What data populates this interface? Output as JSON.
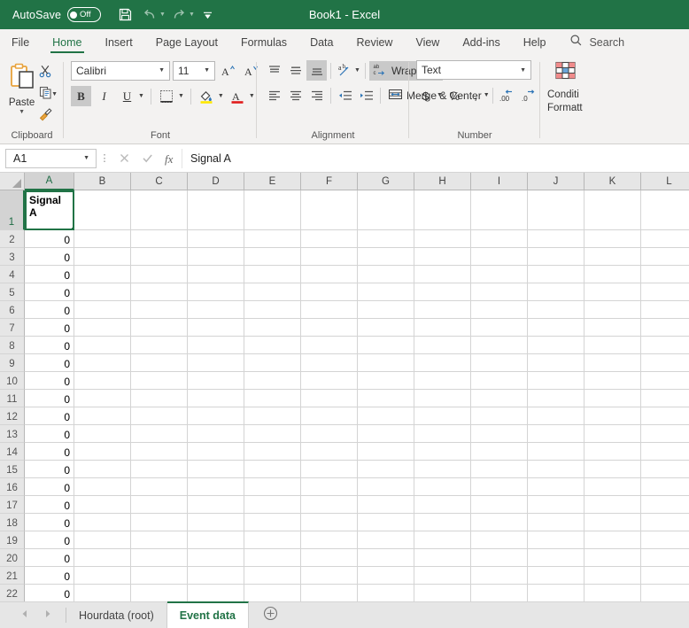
{
  "titlebar": {
    "autosave_label": "AutoSave",
    "autosave_state": "Off",
    "document_title": "Book1  -  Excel",
    "save_icon": "save-icon",
    "undo_icon": "undo-icon",
    "redo_icon": "redo-icon",
    "customize_icon": "customize-quick-access-toolbar-icon",
    "background_color": "#217346"
  },
  "ribbon_tabs": {
    "items": [
      {
        "label": "File",
        "active": false
      },
      {
        "label": "Home",
        "active": true
      },
      {
        "label": "Insert",
        "active": false
      },
      {
        "label": "Page Layout",
        "active": false
      },
      {
        "label": "Formulas",
        "active": false
      },
      {
        "label": "Data",
        "active": false
      },
      {
        "label": "Review",
        "active": false
      },
      {
        "label": "View",
        "active": false
      },
      {
        "label": "Add-ins",
        "active": false
      },
      {
        "label": "Help",
        "active": false
      }
    ],
    "search_label": "Search",
    "search_icon": "search-icon",
    "accent_color": "#217346"
  },
  "ribbon": {
    "clipboard": {
      "group_label": "Clipboard",
      "paste_label": "Paste",
      "paste_icon": "paste-icon",
      "cut_icon": "scissors-icon",
      "copy_icon": "copy-icon",
      "format_painter_icon": "format-painter-icon",
      "dialog_launcher_icon": "dialog-launcher-icon"
    },
    "font": {
      "group_label": "Font",
      "font_name": "Calibri",
      "font_size": "11",
      "grow_font_icon": "increase-font-size-icon",
      "shrink_font_icon": "decrease-font-size-icon",
      "bold_label": "B",
      "bold_active": true,
      "italic_label": "I",
      "underline_label": "U",
      "borders_icon": "borders-icon",
      "fill_color_icon": "fill-color-icon",
      "font_color_icon": "font-color-icon",
      "dialog_launcher_icon": "dialog-launcher-icon"
    },
    "alignment": {
      "group_label": "Alignment",
      "align_top_icon": "align-top-icon",
      "align_middle_icon": "align-middle-icon",
      "align_bottom_icon": "align-bottom-icon",
      "align_bottom_active": true,
      "orientation_icon": "orientation-icon",
      "wrap_text_label": "Wrap Text",
      "wrap_text_active": true,
      "align_left_icon": "align-left-icon",
      "align_center_icon": "align-center-icon",
      "align_right_icon": "align-right-icon",
      "decrease_indent_icon": "decrease-indent-icon",
      "increase_indent_icon": "increase-indent-icon",
      "merge_center_label": "Merge & Center",
      "merge_center_icon": "merge-cells-icon",
      "dialog_launcher_icon": "dialog-launcher-icon"
    },
    "number": {
      "group_label": "Number",
      "format_value": "Text",
      "accounting_icon": "currency-icon",
      "percent_icon": "percent-icon",
      "comma_icon": "comma-style-icon",
      "increase_decimal_icon": "increase-decimal-icon",
      "decrease_decimal_icon": "decrease-decimal-icon",
      "dialog_launcher_icon": "dialog-launcher-icon"
    },
    "styles": {
      "conditional_formatting_line1": "Conditi",
      "conditional_formatting_line2": "Formatt",
      "conditional_formatting_icon": "conditional-formatting-icon"
    }
  },
  "formula_bar": {
    "name_box_value": "A1",
    "name_box_chevron_icon": "chevron-down-icon",
    "cancel_icon": "cancel-icon",
    "enter_icon": "confirm-icon",
    "insert_function_icon": "insert-function-icon",
    "formula_value": "Signal A"
  },
  "grid": {
    "columns": [
      "A",
      "B",
      "C",
      "D",
      "E",
      "F",
      "G",
      "H",
      "I",
      "J",
      "K",
      "L"
    ],
    "selected_column": "A",
    "selected_row": 1,
    "active_cell": "A1",
    "rows": [
      {
        "num": "1",
        "a": "Signal A"
      },
      {
        "num": "2",
        "a": "0"
      },
      {
        "num": "3",
        "a": "0"
      },
      {
        "num": "4",
        "a": "0"
      },
      {
        "num": "5",
        "a": "0"
      },
      {
        "num": "6",
        "a": "0"
      },
      {
        "num": "7",
        "a": "0"
      },
      {
        "num": "8",
        "a": "0"
      },
      {
        "num": "9",
        "a": "0"
      },
      {
        "num": "10",
        "a": "0"
      },
      {
        "num": "11",
        "a": "0"
      },
      {
        "num": "12",
        "a": "0"
      },
      {
        "num": "13",
        "a": "0"
      },
      {
        "num": "14",
        "a": "0"
      },
      {
        "num": "15",
        "a": "0"
      },
      {
        "num": "16",
        "a": "0"
      },
      {
        "num": "17",
        "a": "0"
      },
      {
        "num": "18",
        "a": "0"
      },
      {
        "num": "19",
        "a": "0"
      },
      {
        "num": "20",
        "a": "0"
      },
      {
        "num": "21",
        "a": "0"
      },
      {
        "num": "22",
        "a": "0"
      }
    ]
  },
  "sheet_bar": {
    "prev_icon": "previous-sheet-icon",
    "next_icon": "next-sheet-icon",
    "tabs": [
      {
        "label": "Hourdata (root)",
        "active": false
      },
      {
        "label": "Event data",
        "active": true
      }
    ],
    "add_sheet_icon": "add-sheet-icon",
    "active_color": "#217346"
  }
}
